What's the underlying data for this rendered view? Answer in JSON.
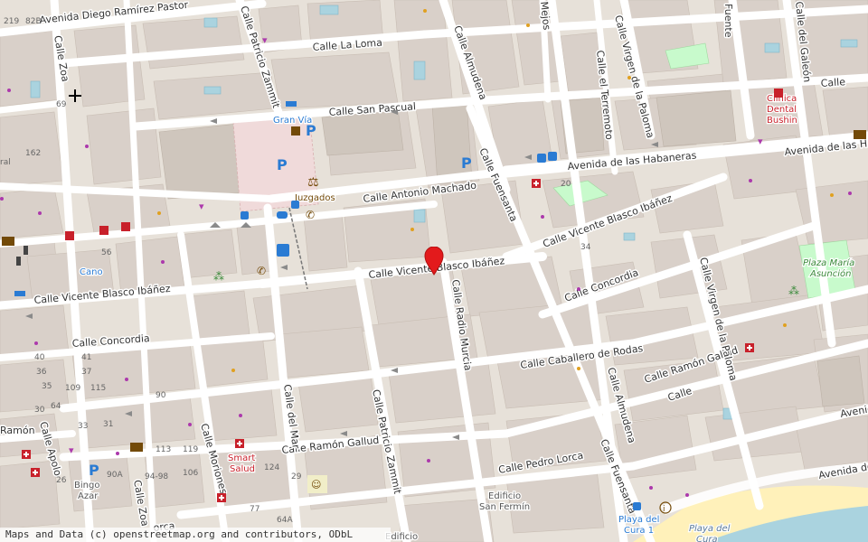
{
  "streets": [
    {
      "name": "Avenida Diego Ramírez Pastor"
    },
    {
      "name": "Calle La Loma"
    },
    {
      "name": "Calle San Pascual"
    },
    {
      "name": "Avenida de las Habaneras"
    },
    {
      "name": "Avenida de las Ha"
    },
    {
      "name": "Calle Antonio Machado"
    },
    {
      "name": "Calle Vicente Blasco Ibáñez"
    },
    {
      "name": "Calle Vicente Blasco Ibáñez"
    },
    {
      "name": "Calle Vicente Blasco Ibáñez"
    },
    {
      "name": "Calle Concordia"
    },
    {
      "name": "Calle Concordia"
    },
    {
      "name": "Calle Caballero de Rodas"
    },
    {
      "name": "Calle Ramón Gallud"
    },
    {
      "name": "Calle Ramón Gallud"
    },
    {
      "name": "Calle Pedro Lorca"
    },
    {
      "name": "Calle Zoa"
    },
    {
      "name": "Calle Zoa"
    },
    {
      "name": "Calle Patricio Zammit"
    },
    {
      "name": "Calle Patricio Zammit"
    },
    {
      "name": "Calle Almudena"
    },
    {
      "name": "Calle Almudena"
    },
    {
      "name": "Calle el Terremoto"
    },
    {
      "name": "Calle Virgen de la Paloma"
    },
    {
      "name": "Calle Virgen de la Paloma"
    },
    {
      "name": "Calle Fuensanta"
    },
    {
      "name": "Calle Fuensanta"
    },
    {
      "name": "Calle Radio Murcia"
    },
    {
      "name": "Calle del Mar"
    },
    {
      "name": "Calle Moriones"
    },
    {
      "name": "Calle Apolo"
    },
    {
      "name": "Calle del Galeón"
    },
    {
      "name": "Fuente"
    },
    {
      "name": "Avenida de la"
    },
    {
      "name": "Ramón"
    },
    {
      "name": "Calle"
    },
    {
      "name": "Calle"
    },
    {
      "name": "Avenida"
    },
    {
      "name": "Mejos"
    },
    {
      "name": "orca"
    }
  ],
  "places": [
    {
      "name": "Gran Vía",
      "color": "#2a7bd3"
    },
    {
      "name": "Juzgados",
      "color": "#734a08"
    },
    {
      "name": "Clínica",
      "color": "#c8202a"
    },
    {
      "name": "Dental",
      "color": "#c8202a"
    },
    {
      "name": "Bushin",
      "color": "#c8202a"
    },
    {
      "name": "Plaza María",
      "color": "#3a8a3a"
    },
    {
      "name": "Asunción",
      "color": "#3a8a3a"
    },
    {
      "name": "Cano",
      "color": "#2a7bd3"
    },
    {
      "name": "Smart",
      "color": "#c8202a"
    },
    {
      "name": "Salud",
      "color": "#c8202a"
    },
    {
      "name": "Bingo",
      "color": "#555555"
    },
    {
      "name": "Azar",
      "color": "#555555"
    },
    {
      "name": "Edificio",
      "color": "#555555"
    },
    {
      "name": "San Fermín",
      "color": "#555555"
    },
    {
      "name": "Playa del",
      "color": "#2a7bd3"
    },
    {
      "name": "Cura 1",
      "color": "#2a7bd3"
    },
    {
      "name": "Playa del",
      "color": "#5a7a9a"
    },
    {
      "name": "Cura",
      "color": "#5a7a9a"
    },
    {
      "name": "Edificio",
      "color": "#555555"
    }
  ],
  "house_numbers": [
    "82B",
    "219",
    "69",
    "162",
    "ral",
    "56",
    "64",
    "40",
    "41",
    "36",
    "37",
    "35",
    "109",
    "115",
    "90",
    "33",
    "31",
    "30",
    "113",
    "119",
    "106",
    "94-98",
    "90A",
    "26",
    "124",
    "29",
    "77",
    "64A",
    "20",
    "34"
  ],
  "attribution": "Maps and Data (c) openstreetmap.org and contributors, ODbL",
  "colors": {
    "background": "#f2efe9",
    "building": "#d9d0c9",
    "road": "#ffffff",
    "park": "#c8facc",
    "beach": "#fff1ba",
    "sea": "#aad3df",
    "marker": "#e31a1c"
  }
}
